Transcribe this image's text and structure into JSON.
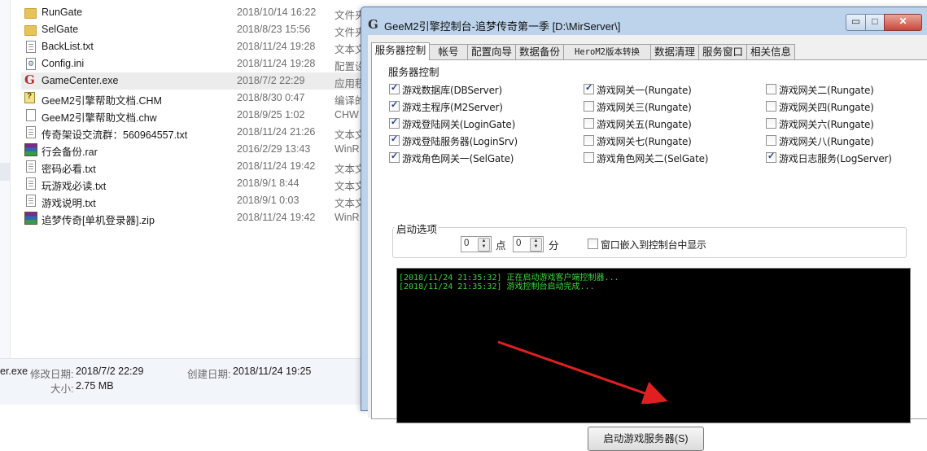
{
  "explorer": {
    "files": [
      {
        "name": "RunGate",
        "date": "2018/10/14 16:22",
        "type": "文件夹",
        "icon": "folder-icon"
      },
      {
        "name": "SelGate",
        "date": "2018/8/23 15:56",
        "type": "文件夹",
        "icon": "folder-icon"
      },
      {
        "name": "BackList.txt",
        "date": "2018/11/24 19:28",
        "type": "文本文",
        "icon": "text-file-icon"
      },
      {
        "name": "Config.ini",
        "date": "2018/11/24 19:28",
        "type": "配置设",
        "icon": "ini-file-icon"
      },
      {
        "name": "GameCenter.exe",
        "date": "2018/7/2 22:29",
        "type": "应用程",
        "icon": "exe-file-icon"
      },
      {
        "name": "GeeM2引擎帮助文档.CHM",
        "date": "2018/8/30 0:47",
        "type": "编译的",
        "icon": "chm-file-icon"
      },
      {
        "name": "GeeM2引擎帮助文档.chw",
        "date": "2018/9/25 1:02",
        "type": "CHW",
        "icon": "chw-file-icon"
      },
      {
        "name": "传奇架设交流群：560964557.txt",
        "date": "2018/11/24 21:26",
        "type": "文本文",
        "icon": "text-file-icon"
      },
      {
        "name": "行会备份.rar",
        "date": "2016/2/29 13:43",
        "type": "WinR",
        "icon": "rar-file-icon"
      },
      {
        "name": "密码必看.txt",
        "date": "2018/11/24 19:42",
        "type": "文本文",
        "icon": "text-file-icon"
      },
      {
        "name": "玩游戏必读.txt",
        "date": "2018/9/1 8:44",
        "type": "文本文",
        "icon": "text-file-icon"
      },
      {
        "name": "游戏说明.txt",
        "date": "2018/9/1 0:03",
        "type": "文本文",
        "icon": "text-file-icon"
      },
      {
        "name": "追梦传奇[单机登录器].zip",
        "date": "2018/11/24 19:42",
        "type": "WinR",
        "icon": "rar-file-icon"
      }
    ],
    "details": {
      "filename": "er.exe",
      "modified_label": "修改日期:",
      "modified_value": "2018/7/2 22:29",
      "created_label": "创建日期:",
      "created_value": "2018/11/24 19:25",
      "size_label": "大小:",
      "size_value": "2.75 MB"
    }
  },
  "dialog": {
    "title": "GeeM2引擎控制台-追梦传奇第一季 [D:\\MirServer\\]",
    "app_icon": "G",
    "min_glyph": "▭",
    "max_glyph": "□",
    "close_glyph": "✕",
    "tabs": [
      "服务器控制",
      "帐号",
      "配置向导",
      "数据备份",
      "HeroM2版本转换",
      "数据清理",
      "服务窗口",
      "相关信息"
    ],
    "group_title": "服务器控制",
    "checkboxes": [
      {
        "label": "游戏数据库(DBServer)",
        "checked": true
      },
      {
        "label": "游戏网关一(Rungate)",
        "checked": true
      },
      {
        "label": "游戏网关二(Rungate)",
        "checked": false
      },
      {
        "label": "游戏主程序(M2Server)",
        "checked": true
      },
      {
        "label": "游戏网关三(Rungate)",
        "checked": false
      },
      {
        "label": "游戏网关四(Rungate)",
        "checked": false
      },
      {
        "label": "游戏登陆网关(LoginGate)",
        "checked": true
      },
      {
        "label": "游戏网关五(Rungate)",
        "checked": false
      },
      {
        "label": "游戏网关六(Rungate)",
        "checked": false
      },
      {
        "label": "游戏登陆服务器(LoginSrv)",
        "checked": true
      },
      {
        "label": "游戏网关七(Rungate)",
        "checked": false
      },
      {
        "label": "游戏网关八(Rungate)",
        "checked": false
      },
      {
        "label": "游戏角色网关一(SelGate)",
        "checked": true
      },
      {
        "label": "游戏角色网关二(SelGate)",
        "checked": false
      },
      {
        "label": "游戏日志服务(LogServer)",
        "checked": true
      }
    ],
    "startup": {
      "title": "启动选项",
      "hour_value": "0",
      "hour_unit": "点",
      "minute_value": "0",
      "minute_unit": "分",
      "embed_label": "窗口嵌入到控制台中显示",
      "embed_checked": false
    },
    "log": [
      "[2018/11/24 21:35:32] 正在启动游戏客户端控制器...",
      "[2018/11/24 21:35:32] 游戏控制台启动完成..."
    ],
    "start_button": "启动游戏服务器(S)"
  },
  "colors": {
    "log_text": "#39d839",
    "console_bg": "#000000",
    "annotation_arrow": "#e02020",
    "dialog_frame": "#bcd3eb"
  }
}
